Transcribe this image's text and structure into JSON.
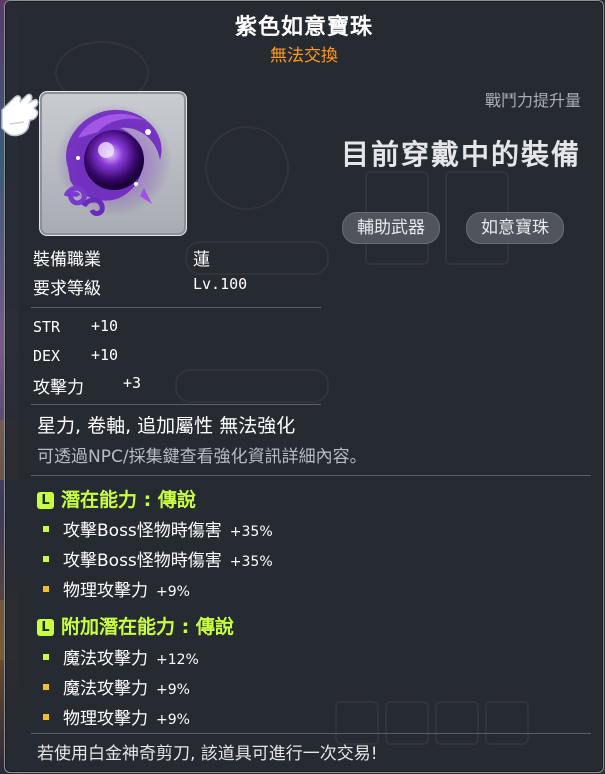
{
  "colors": {
    "title": "#ffffff",
    "untradeable": "#ff9a1a",
    "potential_header": "#c9ff42",
    "legendary_bullet": "#c9ff42",
    "unique_bullet": "#f0c030",
    "note_gray": "#b8bcc4"
  },
  "item": {
    "name": "紫色如意寶珠",
    "trade_status": "無法交換",
    "icon": "purple-orb-icon"
  },
  "compare": {
    "label": "戰鬥力提升量",
    "equipped_text": "目前穿戴中的裝備",
    "tags": [
      "輔助武器",
      "如意寶珠"
    ]
  },
  "requirements": [
    {
      "label": "裝備職業",
      "value": "蓮"
    },
    {
      "label": "要求等級",
      "value": "Lv.100"
    }
  ],
  "stats": [
    {
      "label": "STR",
      "value": "+10"
    },
    {
      "label": "DEX",
      "value": "+10"
    },
    {
      "label": "攻擊力",
      "value": "+3"
    }
  ],
  "enhance_note": "星力, 卷軸, 追加屬性 無法強化",
  "info_note": "可透過NPC/採集鍵查看強化資訊詳細內容。",
  "potential": {
    "header": "潛在能力 : 傳說",
    "icon_letter": "L",
    "lines": [
      {
        "label": "攻擊Boss怪物時傷害",
        "value": "+35%",
        "tier": "legendary"
      },
      {
        "label": "攻擊Boss怪物時傷害",
        "value": "+35%",
        "tier": "legendary"
      },
      {
        "label": "物理攻擊力",
        "value": "+9%",
        "tier": "unique"
      }
    ]
  },
  "bonus_potential": {
    "header": "附加潛在能力 : 傳說",
    "icon_letter": "L",
    "lines": [
      {
        "label": "魔法攻擊力",
        "value": "+12%",
        "tier": "legendary"
      },
      {
        "label": "魔法攻擊力",
        "value": "+9%",
        "tier": "unique"
      },
      {
        "label": "物理攻擊力",
        "value": "+9%",
        "tier": "unique"
      }
    ]
  },
  "footer_note": "若使用白金神奇剪刀, 該道具可進行一次交易!"
}
